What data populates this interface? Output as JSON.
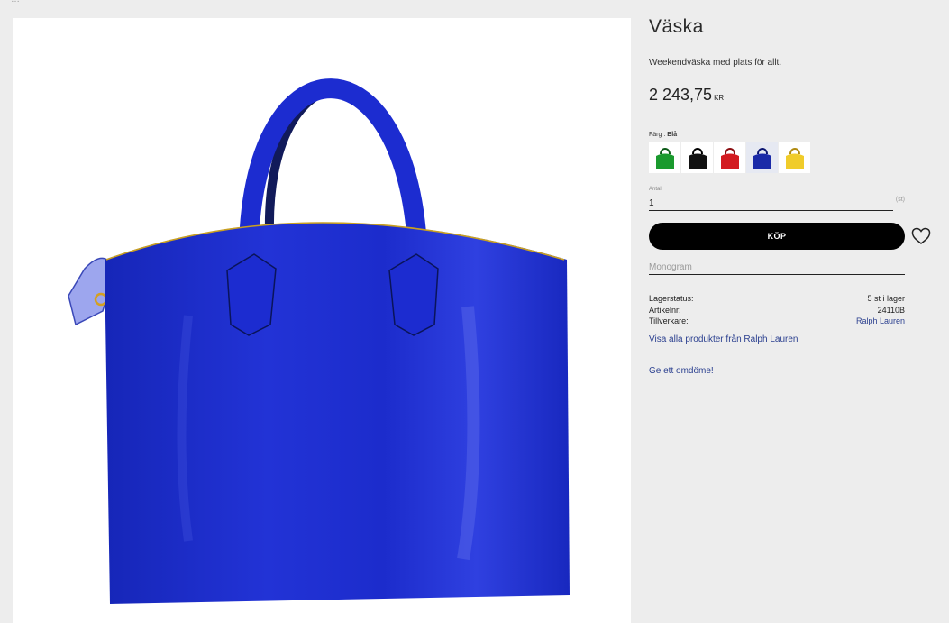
{
  "breadcrumb": "…",
  "product": {
    "title": "Väska",
    "description": "Weekendväska med plats för allt.",
    "price": "2 243,75",
    "currency": "KR",
    "color_label": "Färg :",
    "color_value": "Blå",
    "colors": [
      {
        "name": "green",
        "hex": "#1a9a2e"
      },
      {
        "name": "black",
        "hex": "#111111"
      },
      {
        "name": "red",
        "hex": "#d31a20"
      },
      {
        "name": "blue",
        "hex": "#1a2aa8",
        "selected": true
      },
      {
        "name": "yellow",
        "hex": "#f0cc2a"
      }
    ],
    "main_color": "#1f2fcc"
  },
  "quantity": {
    "label": "Antal",
    "value": "1",
    "unit": "(st)"
  },
  "buy_label": "KÖP",
  "wishlist_icon": "heart-icon",
  "monogram": {
    "placeholder": "Monogram"
  },
  "specs": {
    "stock_label": "Lagerstatus:",
    "stock_value": "5 st i lager",
    "article_label": "Artikelnr:",
    "article_value": "24110B",
    "maker_label": "Tillverkare:",
    "maker_value": "Ralph Lauren"
  },
  "links": {
    "all_products": "Visa alla produkter från Ralph Lauren",
    "review": "Ge ett omdöme!"
  }
}
